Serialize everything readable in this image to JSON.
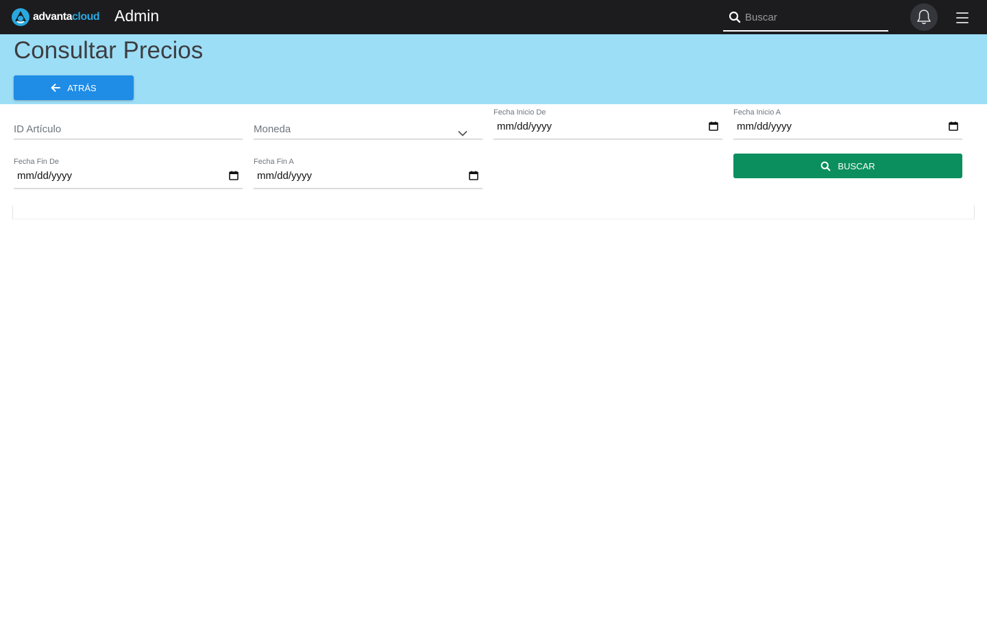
{
  "topbar": {
    "logo_word_1": "advanta",
    "logo_word_2": "cloud",
    "app_title": "Admin",
    "search_placeholder": "Buscar",
    "icons": {
      "search": "search-icon",
      "bell": "bell-icon",
      "menu": "hamburger-menu-icon"
    }
  },
  "header": {
    "title": "Consultar Precios",
    "back_button_label": "ATRÁS",
    "background_color": "#9ddef7"
  },
  "filters": {
    "id_articulo": {
      "placeholder": "ID Artículo"
    },
    "moneda": {
      "placeholder": "Moneda"
    },
    "fecha_inicio_de": {
      "label": "Fecha Inicio De",
      "value": "mm/dd/yyyy"
    },
    "fecha_inicio_a": {
      "label": "Fecha Inicio A",
      "value": "mm/dd/yyyy"
    },
    "fecha_fin_de": {
      "label": "Fecha Fin De",
      "value": "mm/dd/yyyy"
    },
    "fecha_fin_a": {
      "label": "Fecha Fin A",
      "value": "mm/dd/yyyy"
    },
    "search_button_label": "BUSCAR"
  },
  "colors": {
    "topbar": "#1c1c1e",
    "primary_button": "#1f8ce6",
    "search_button": "#0b8f5e",
    "brand_accent": "#29a8e0"
  }
}
